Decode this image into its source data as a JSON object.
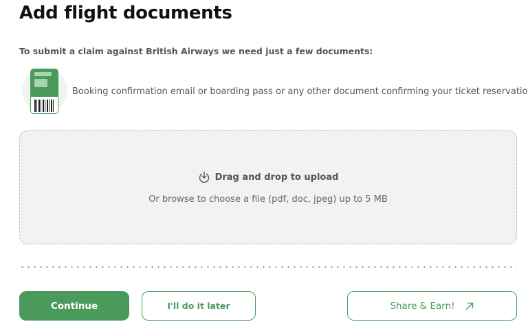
{
  "header": {
    "title": "Add flight documents"
  },
  "intro_text": "To submit a claim against British Airways we need just a few documents:",
  "documents": [
    {
      "icon": "boarding-pass-icon",
      "label": "Booking confirmation email or boarding pass or any other document confirming your ticket reservation"
    }
  ],
  "upload": {
    "icon": "download-icon",
    "title": "Drag and drop to upload",
    "subtitle": "Or browse to choose a file (pdf, doc, jpeg) up to 5 MB"
  },
  "actions": {
    "continue_label": "Continue",
    "later_label": "I'll do it later",
    "share_label": "Share & Earn!",
    "share_icon": "arrow-up-right-icon"
  },
  "colors": {
    "accent": "#4a9a5b",
    "dropzone_bg": "#f2f2f2"
  }
}
